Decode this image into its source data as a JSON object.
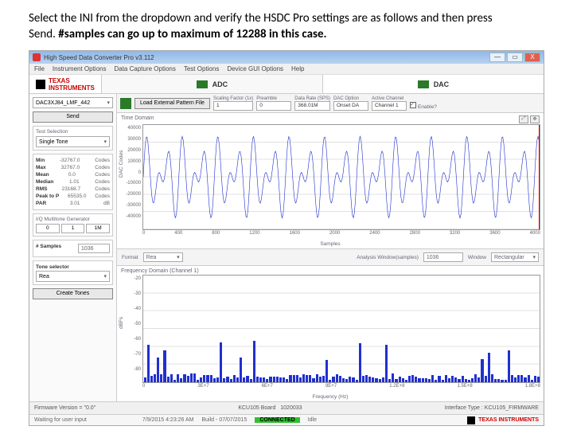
{
  "instruction": {
    "l1a": "Select the INI from the dropdown and verify the HSDC Pro settings are as follows and then press",
    "l1b": "Send. ",
    "l1c": "#samples can go up to maximum of 12288 in this case."
  },
  "titlebar": {
    "title": "High Speed Data Converter Pro v3.112"
  },
  "winbtns": {
    "min": "—",
    "max": "▭",
    "close": "X"
  },
  "menu": {
    "file": "File",
    "inst": "Instrument Options",
    "dcap": "Data Capture Options",
    "test": "Test Options",
    "dev": "Device GUI Options",
    "help": "Help"
  },
  "brand": {
    "ti": "TEXAS",
    "ti2": "INSTRUMENTS"
  },
  "tabs": {
    "adc": "ADC",
    "dac": "DAC"
  },
  "side": {
    "ini": "DAC3XJ84_LMF_442",
    "send": "Send",
    "testsel_t": "Test Selection",
    "testsel": "Single Tone",
    "stats": [
      {
        "k": "Min",
        "v": "-32767.0",
        "u": "Codes"
      },
      {
        "k": "Max",
        "v": "32767.0",
        "u": "Codes"
      },
      {
        "k": "Mean",
        "v": "0.0",
        "u": "Codes"
      },
      {
        "k": "Median",
        "v": "1.01",
        "u": "Codes"
      },
      {
        "k": "RMS",
        "v": "23168.7",
        "u": "Codes"
      },
      {
        "k": "Peak to P",
        "v": "65535.0",
        "u": "Codes"
      },
      {
        "k": "PAR",
        "v": "3.01",
        "u": "dB"
      }
    ],
    "ifmc_t": "I/Q Multitone Generator",
    "row3": {
      "a": "0",
      "b": "1",
      "c": "1M"
    },
    "nsamp_t": "# Samples",
    "nsamp": "1036",
    "tone_t": "Tone selector",
    "tone": "Rea",
    "create": "Create Tones"
  },
  "opt": {
    "load": "Load External Pattern File",
    "scale_t": "Scaling Factor (1x)",
    "scale": "1",
    "pre_t": "Preamble",
    "pre": "0",
    "rate_t": "Data Rate (SPS)",
    "rate": "368.01M",
    "dacopt_t": "DAC Option",
    "dacopt": "Onset DA",
    "ch_t": "Active Channel",
    "ch": "Channel 1",
    "en2": "Enable?"
  },
  "chart_data": [
    {
      "type": "line",
      "title": "Time Domain",
      "ylabel": "DAC Codes",
      "xlabel": "Samples",
      "ylim": [
        -40000,
        40000
      ],
      "yticks": [
        40000,
        30000,
        20000,
        10000,
        0,
        -10000,
        -20000,
        -30000,
        -40000
      ],
      "xlim": [
        0,
        4300
      ],
      "xticks": [
        0,
        200,
        400,
        600,
        800,
        1000,
        1200,
        1400,
        1600,
        1800,
        2000,
        2200,
        2400,
        2600,
        2800,
        3000,
        3200,
        3400,
        3600,
        3800,
        4000,
        4200
      ],
      "series": [
        {
          "name": "Channel 1",
          "note": "dense oscillating waveform approx ±32767"
        }
      ]
    },
    {
      "type": "bar",
      "title": "Frequency Domain (Channel 1)",
      "ylabel": "dBFs",
      "xlabel": "Frequency (Hz)",
      "ylim": [
        -80,
        -20
      ],
      "yticks": [
        -20,
        -30,
        -40,
        -50,
        -60,
        -70,
        -80
      ],
      "xlim": [
        0,
        180000000
      ],
      "xticks": [
        "0",
        "1E+7",
        "2E+7",
        "3E+7",
        "4E+7",
        "5E+7",
        "6E+7",
        "7E+7",
        "8E+7",
        "9E+7",
        "1E+8",
        "1.1E+8",
        "1.2E+8",
        "1.3E+8",
        "1.4E+8",
        "1.5E+8",
        "1.6E+8",
        "1.7E+8",
        "1.8E+8"
      ],
      "series": [
        {
          "name": "spectrum",
          "note": "many short spikes across band"
        }
      ]
    }
  ],
  "mid": {
    "fmt_t": "Samples",
    "fmt_t2": "Format",
    "fmt": "Rea",
    "awin_t": "Analysis Window(samples)",
    "awin": "1036",
    "win_t": "Window",
    "win": "Rectangular"
  },
  "status1": {
    "fw_t": "Firmware Version",
    "fw": "\"0.0\"",
    "board": "KCU105 Board",
    "boardid": "1020033",
    "iface_t": "Interface Type",
    "iface": "KCU105_FIRMWARE"
  },
  "status2": {
    "wait": "Waiting for user input",
    "ts": "7/9/2015 4:23:26 AM",
    "build_t": "Build",
    "build": "07/07/2015",
    "conn": "CONNECTED",
    "idle": "Idle",
    "ti": "TEXAS INSTRUMENTS"
  }
}
